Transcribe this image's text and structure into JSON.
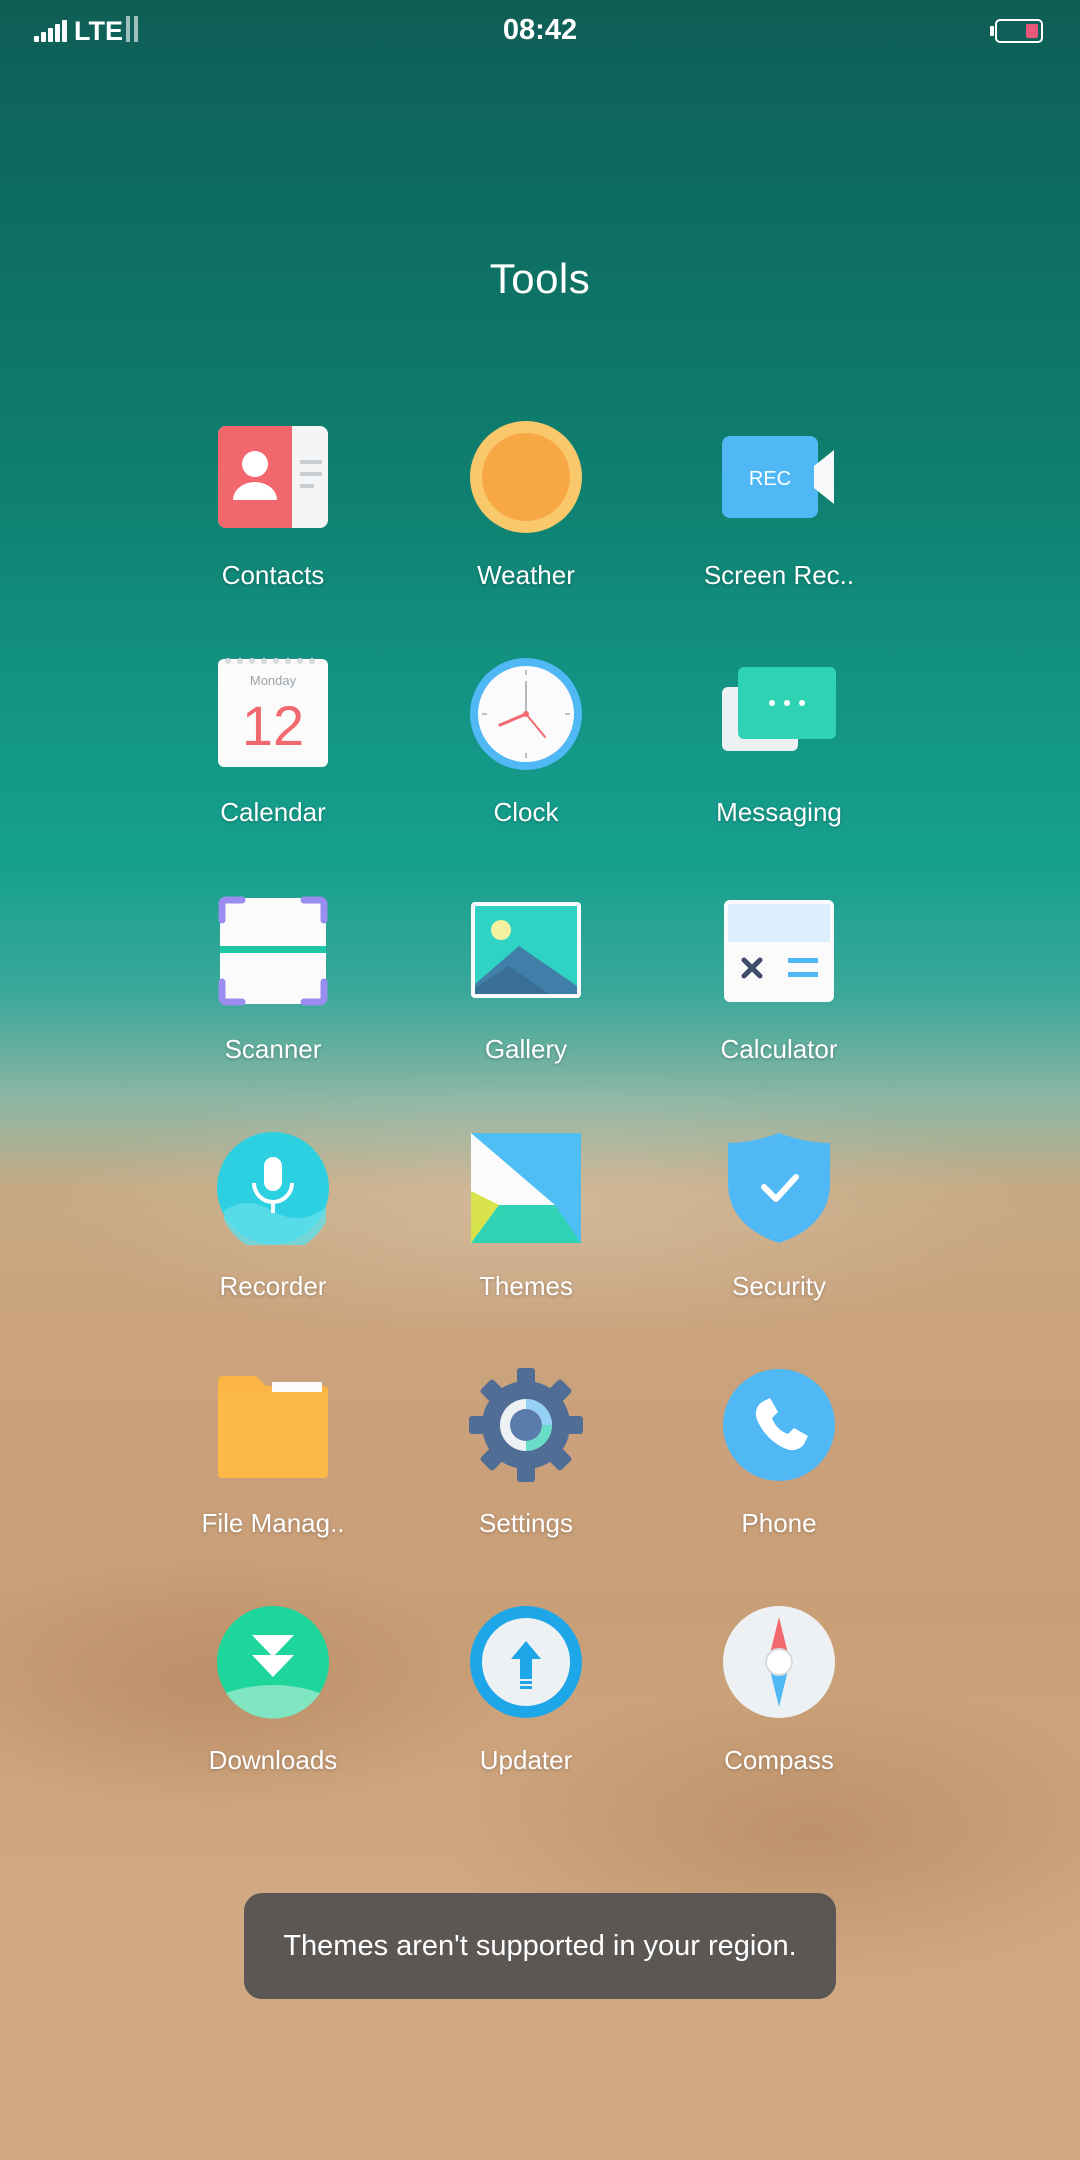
{
  "status_bar": {
    "network": "LTE",
    "time": "08:42",
    "battery_color": "#e8567a"
  },
  "folder": {
    "title": "Tools"
  },
  "apps": [
    {
      "label": "Contacts",
      "icon": "contacts-icon"
    },
    {
      "label": "Weather",
      "icon": "sun-icon"
    },
    {
      "label": "Screen Rec..",
      "icon": "video-camera-icon"
    },
    {
      "label": "Calendar",
      "icon": "calendar-icon",
      "icon_text": {
        "day": "Monday",
        "date": "12"
      }
    },
    {
      "label": "Clock",
      "icon": "clock-icon"
    },
    {
      "label": "Messaging",
      "icon": "chat-bubble-icon"
    },
    {
      "label": "Scanner",
      "icon": "scanner-icon"
    },
    {
      "label": "Gallery",
      "icon": "picture-icon"
    },
    {
      "label": "Calculator",
      "icon": "calculator-icon"
    },
    {
      "label": "Recorder",
      "icon": "microphone-icon"
    },
    {
      "label": "Themes",
      "icon": "themes-icon"
    },
    {
      "label": "Security",
      "icon": "shield-icon"
    },
    {
      "label": "File Manag..",
      "icon": "folder-icon"
    },
    {
      "label": "Settings",
      "icon": "gear-icon"
    },
    {
      "label": "Phone",
      "icon": "phone-icon"
    },
    {
      "label": "Downloads",
      "icon": "download-icon"
    },
    {
      "label": "Updater",
      "icon": "update-arrow-icon"
    },
    {
      "label": "Compass",
      "icon": "compass-icon"
    }
  ],
  "toast": {
    "message": "Themes aren't supported in your region."
  }
}
